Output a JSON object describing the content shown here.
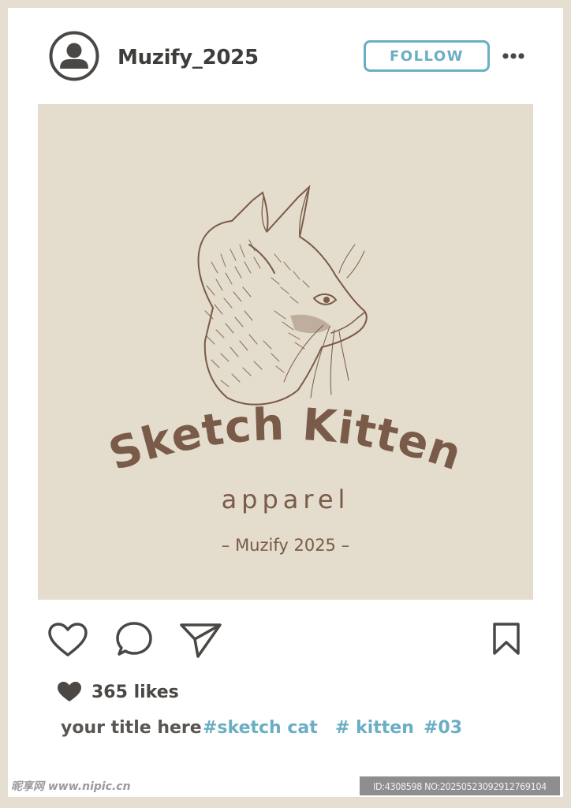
{
  "post": {
    "username": "Muzify_2025",
    "follow_label": "FOLLOW",
    "likes": "365 likes",
    "caption_title": "your title here",
    "tags": [
      "#sketch  cat",
      "# kitten",
      "#03"
    ]
  },
  "artwork": {
    "title": "Sketch Kitten",
    "subtitle": "apparel",
    "brand_line": "– Muzify 2025 –"
  },
  "watermark": {
    "site": "昵享网 www.nipic.cn",
    "id_line": "ID:4308598 NO:20250523092912769104"
  },
  "icons": {
    "avatar": "user-avatar-icon",
    "more": "more-dots-icon",
    "like": "heart-outline-icon",
    "comment": "comment-bubble-icon",
    "share": "paper-plane-icon",
    "save": "bookmark-icon",
    "likes": "heart-filled-icon"
  },
  "colors": {
    "accent": "#6aaec4",
    "photo_bg": "#e4dccc",
    "artwork_brown": "#7a5a48",
    "icon_dark": "#4a4744",
    "frame": "#e6dfd1"
  }
}
